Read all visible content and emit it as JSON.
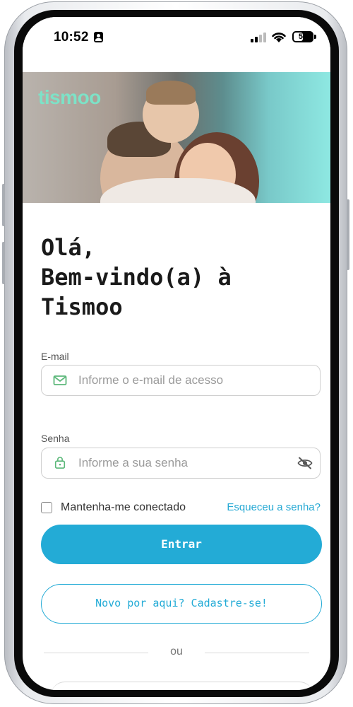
{
  "status_bar": {
    "time": "10:52",
    "battery_level": "50",
    "battery_fraction": 0.5
  },
  "hero": {
    "logo": "tismoo",
    "logo_color": "#7de2c7"
  },
  "greeting": {
    "line1": "Olá,",
    "line2": "Bem-vindo(a) à",
    "line3": "Tismoo"
  },
  "form": {
    "email": {
      "label": "E-mail",
      "placeholder": "Informe o e-mail de acesso",
      "value": "",
      "icon": "mail-icon"
    },
    "password": {
      "label": "Senha",
      "placeholder": "Informe a sua senha",
      "value": "",
      "icon": "lock-icon",
      "toggle_icon": "eye-off-icon"
    },
    "remember_label": "Mantenha-me conectado",
    "remember_checked": false,
    "forgot_label": "Esqueceu a senha?"
  },
  "actions": {
    "login_label": "Entrar",
    "signup_label": "Novo por aqui? Cadastre-se!",
    "divider_label": "ou"
  },
  "colors": {
    "accent": "#23abd6",
    "icon_green": "#5cb87a",
    "text_dark": "#1a1a1a"
  }
}
